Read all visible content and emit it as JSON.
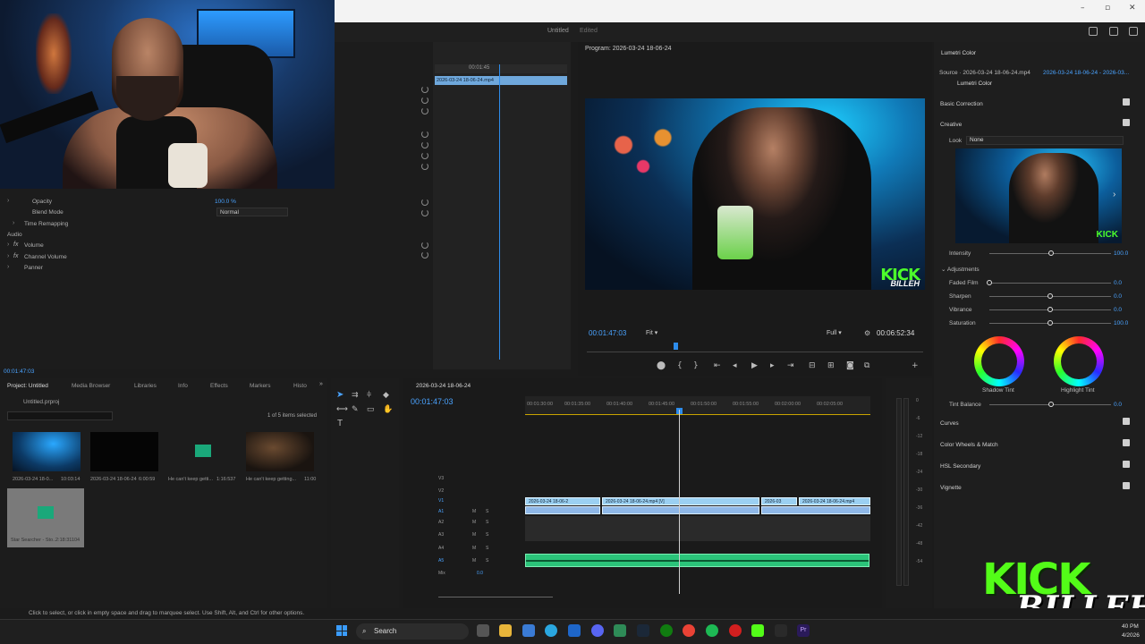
{
  "window": {
    "title": "Untitled",
    "status": "Edited"
  },
  "effect_controls": {
    "rows": [
      {
        "label": "Opacity",
        "value": "100.0 %"
      },
      {
        "label": "Blend Mode",
        "value": "Normal"
      },
      {
        "label": "Time Remapping"
      },
      {
        "label": "Audio"
      },
      {
        "label": "Volume"
      },
      {
        "label": "Channel Volume"
      },
      {
        "label": "Panner"
      }
    ],
    "ruler_tc": "00:01:45",
    "clip_name": "2026-03-24 18-06-24.mp4",
    "current_tc": "00:01:47:03"
  },
  "program": {
    "title": "Program: 2026-03-24 18-06-24",
    "timecode": "00:01:47:03",
    "zoom": "Fit",
    "resolution": "Full",
    "duration": "00:06:52:34"
  },
  "lumetri": {
    "title": "Lumetri Color",
    "source": "Source · 2026-03-24 18-06-24.mp4",
    "sequence": "2026-03-24 18-06-24 - 2026-03...",
    "effect": "Lumetri Color",
    "basic": "Basic Correction",
    "creative": "Creative",
    "look_label": "Look",
    "look_value": "None",
    "intensity_label": "Intensity",
    "intensity_value": "100.0",
    "adjustments": "Adjustments",
    "sliders": [
      {
        "label": "Faded Film",
        "value": "0.0",
        "level": 0
      },
      {
        "label": "Sharpen",
        "value": "0.0",
        "level": 0.5
      },
      {
        "label": "Vibrance",
        "value": "0.0",
        "level": 0.5
      },
      {
        "label": "Saturation",
        "value": "100.0",
        "level": 0.5
      }
    ],
    "shadow_tint": "Shadow Tint",
    "highlight_tint": "Highlight Tint",
    "tint_balance_label": "Tint Balance",
    "tint_balance_value": "0.0",
    "sections": [
      "Curves",
      "Color Wheels & Match",
      "HSL Secondary",
      "Vignette"
    ]
  },
  "project": {
    "tabs": [
      "Project: Untitled",
      "Media Browser",
      "Libraries",
      "Info",
      "Effects",
      "Markers",
      "Histo"
    ],
    "file": "Untitled.prproj",
    "selection": "1 of 5 items selected",
    "items": [
      {
        "name": "2026-03-24 18-0...",
        "dur": "10:03:14"
      },
      {
        "name": "2026-03-24 18-06-24",
        "dur": "6:00:59"
      },
      {
        "name": "He can't keep getti...",
        "dur": "1:16:537"
      },
      {
        "name": "He can't keep getting...",
        "dur": "11:00"
      },
      {
        "name": "Star Searcher - Sto...",
        "dur": "2:18:31104"
      }
    ]
  },
  "timeline": {
    "title": "2026-03-24 18-06-24",
    "timecode": "00:01:47:03",
    "ruler": [
      "00:01:30:00",
      "00:01:35:00",
      "00:01:40:00",
      "00:01:45:00",
      "00:01:50:00",
      "00:01:55:00",
      "00:02:00:00",
      "00:02:05:00"
    ],
    "tracks": [
      "V3",
      "V2",
      "V1",
      "A1",
      "A2",
      "A3",
      "A4",
      "A5",
      "Mix"
    ],
    "track_flags": [
      "M",
      "S"
    ],
    "mix_value": "0.0",
    "clips": [
      "2026-03-24 18-06-2",
      "2026-03-24 18-06-24.mp4 [V]",
      "2026-03",
      "2026-03-24 18-06-24.mp4"
    ]
  },
  "meters": [
    "0",
    "-6",
    "-12",
    "-18",
    "-24",
    "-30",
    "-36",
    "-42",
    "-48",
    "-54"
  ],
  "status_text": "Click to select, or click in empty space and drag to marquee select. Use Shift, Alt, and Ctrl for other options.",
  "taskbar": {
    "search": "Search",
    "time": "40 PM",
    "date": "4/2026"
  },
  "overlay": {
    "kick": "KICK",
    "billeh": "BILLEH",
    "small_kick": "KICK",
    "small_billeh": "BILLEH"
  },
  "colors": {
    "accent": "#2d8ceb",
    "kick_green": "#53fc18",
    "audio_green": "#2bc47a",
    "video_clip": "#9bd0f2"
  }
}
